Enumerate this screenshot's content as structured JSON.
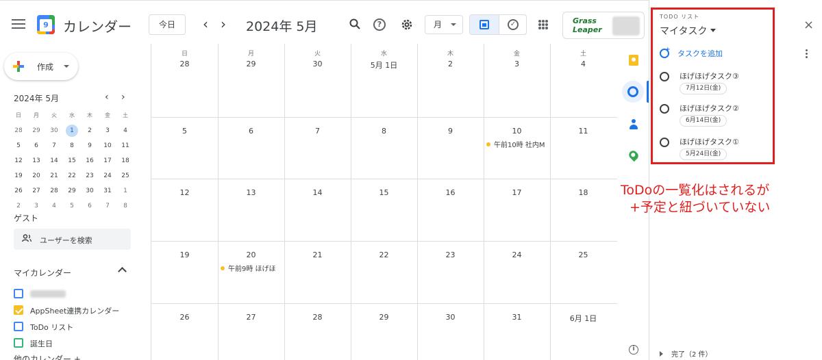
{
  "header": {
    "app_title": "カレンダー",
    "logo_digit": "9",
    "today_label": "今日",
    "prev": "‹",
    "next": "›",
    "month_title": "2024年 5月",
    "view_select": "月",
    "brand_logo": "Grass Leaper"
  },
  "sidebar": {
    "create_label": "作成",
    "mini_calendar": {
      "title": "2024年 5月",
      "prev": "‹",
      "next": "›",
      "weekdays": [
        "日",
        "月",
        "火",
        "水",
        "木",
        "金",
        "土"
      ],
      "weeks": [
        [
          "28",
          "29",
          "30",
          "1",
          "2",
          "3",
          "4"
        ],
        [
          "5",
          "6",
          "7",
          "8",
          "9",
          "10",
          "11"
        ],
        [
          "12",
          "13",
          "14",
          "15",
          "16",
          "17",
          "18"
        ],
        [
          "19",
          "20",
          "21",
          "22",
          "23",
          "24",
          "25"
        ],
        [
          "26",
          "27",
          "28",
          "29",
          "30",
          "31",
          "1"
        ],
        [
          "2",
          "3",
          "4",
          "5",
          "6",
          "7",
          "8"
        ]
      ],
      "selected": "1"
    },
    "guest_label": "ゲスト",
    "guest_search_placeholder": "ユーザーを検索",
    "my_calendars_label": "マイカレンダー",
    "my_calendars": [
      {
        "label": "",
        "checked": false,
        "color": "#4285f4",
        "blurred": true
      },
      {
        "label": "AppSheet連携カレンダー",
        "checked": true,
        "color": "#f6bf26",
        "blurred": false
      },
      {
        "label": "ToDo リスト",
        "checked": false,
        "color": "#4285f4",
        "blurred": false
      },
      {
        "label": "誕生日",
        "checked": false,
        "color": "#33b679",
        "blurred": false
      }
    ],
    "other_calendars_label": "他のカレンダー +"
  },
  "month_grid": {
    "weekdays": [
      "日",
      "月",
      "火",
      "水",
      "木",
      "金",
      "土"
    ],
    "weeks": [
      [
        "28",
        "29",
        "30",
        "5月 1日",
        "2",
        "3",
        "4"
      ],
      [
        "5",
        "6",
        "7",
        "8",
        "9",
        "10",
        "11"
      ],
      [
        "12",
        "13",
        "14",
        "15",
        "16",
        "17",
        "18"
      ],
      [
        "19",
        "20",
        "21",
        "22",
        "23",
        "24",
        "25"
      ],
      [
        "26",
        "27",
        "28",
        "29",
        "30",
        "31",
        "6月 1日"
      ]
    ],
    "events": [
      {
        "week": 1,
        "day": 5,
        "text": "午前10時 社内M"
      },
      {
        "week": 3,
        "day": 1,
        "text": "午前9時 ほげほ"
      }
    ]
  },
  "tasks_panel": {
    "kicker": "TODO リスト",
    "list_title": "マイタスク",
    "close": "×",
    "add_task": "タスクを追加",
    "tasks": [
      {
        "name": "ほげほげタスク③",
        "date": "7月12日(金)"
      },
      {
        "name": "ほげほげタスク②",
        "date": "6月14日(金)"
      },
      {
        "name": "ほげほげタスク①",
        "date": "5月24日(金)"
      }
    ],
    "completed": "完了（2 件）"
  },
  "annotation": {
    "line1": "ToDoの一覧化はされるが",
    "line2": "+予定と紐づいていない"
  },
  "colors": {
    "accent": "#1a73e8",
    "event_dot": "#f6bf26",
    "annotation": "#e0201e"
  }
}
